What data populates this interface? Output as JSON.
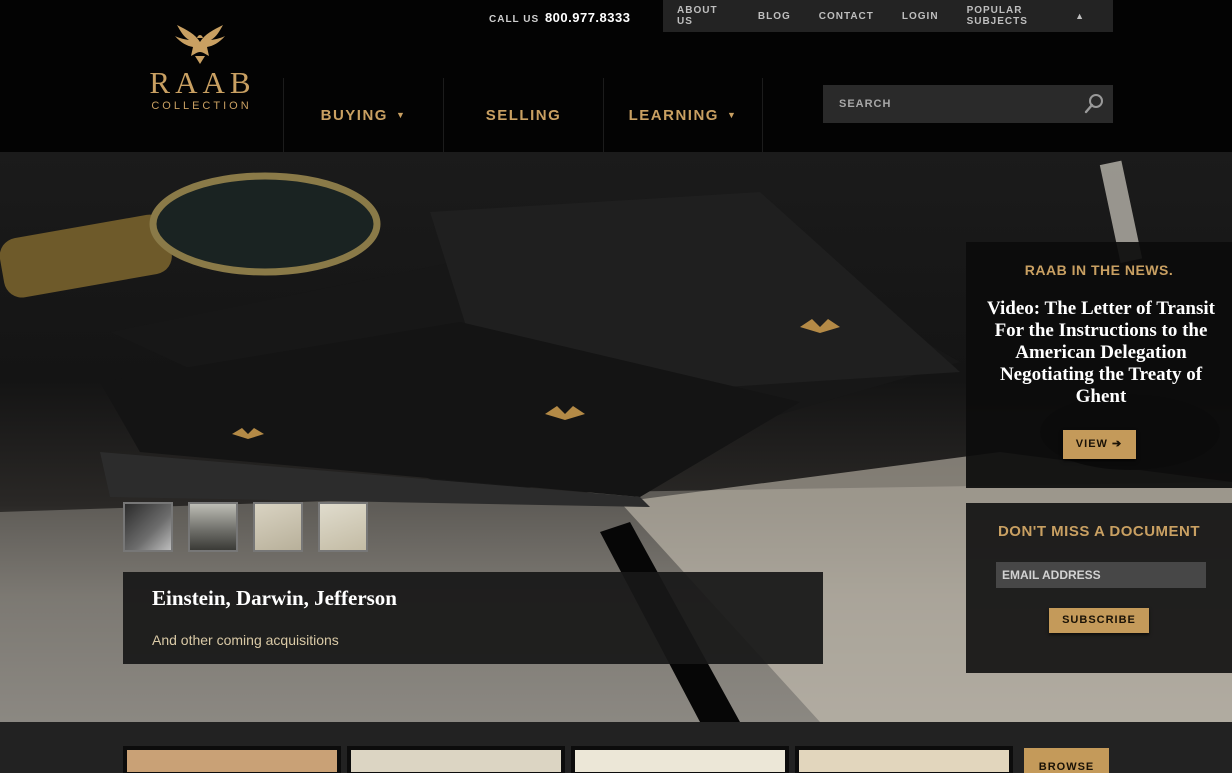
{
  "header": {
    "call_label": "CALL US",
    "phone": "800.977.8333",
    "utility_nav": [
      "ABOUT US",
      "BLOG",
      "CONTACT",
      "LOGIN",
      "POPULAR SUBJECTS"
    ],
    "logo_word": "RAAB",
    "logo_sub": "COLLECTION",
    "main_nav": {
      "buying": "BUYING",
      "selling": "SELLING",
      "learning": "LEARNING"
    },
    "search": {
      "placeholder": "SEARCH"
    }
  },
  "hero": {
    "caption_title": "Einstein, Darwin, Jefferson",
    "caption_sub": "And other coming acquisitions",
    "thumbnails": 4
  },
  "news": {
    "heading": "RAAB IN THE NEWS.",
    "title": "Video: The Letter of Transit For the Instructions to the American Delegation Negotiating the Treaty of Ghent",
    "button": "VIEW ➔"
  },
  "subscribe": {
    "heading": "DON'T MISS A DOCUMENT",
    "placeholder": "EMAIL ADDRESS",
    "button": "SUBSCRIBE"
  },
  "strip": {
    "browse": "BROWSE"
  },
  "colors": {
    "accent_gold": "#c9a062",
    "button_gold": "#c49a5a",
    "header_bg": "#030303",
    "util_bg": "#232323"
  },
  "icons": {
    "logo": "eagle-icon",
    "search": "magnifier-icon",
    "dropdown": "caret-down-icon",
    "popular_subjects": "triangle-up-icon"
  }
}
